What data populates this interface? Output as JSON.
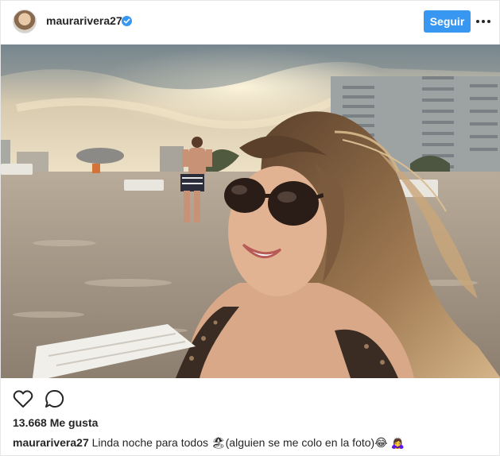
{
  "header": {
    "username": "maurarivera27",
    "verified_icon": "verified-badge-icon",
    "follow_label": "Seguir",
    "more_icon": "more-options-icon"
  },
  "photo": {
    "alt_hint": "beach-selfie"
  },
  "actions": {
    "like_icon": "heart-icon",
    "comment_icon": "comment-icon"
  },
  "likes": {
    "text": "13.668 Me gusta"
  },
  "caption": {
    "username": "maurarivera27",
    "text": "Linda noche para todos 🏖(alguien se me colo en la foto)😂  🙇‍♀️"
  },
  "colors": {
    "accent": "#3897f0",
    "text": "#262626",
    "border": "#e6e6e6"
  }
}
